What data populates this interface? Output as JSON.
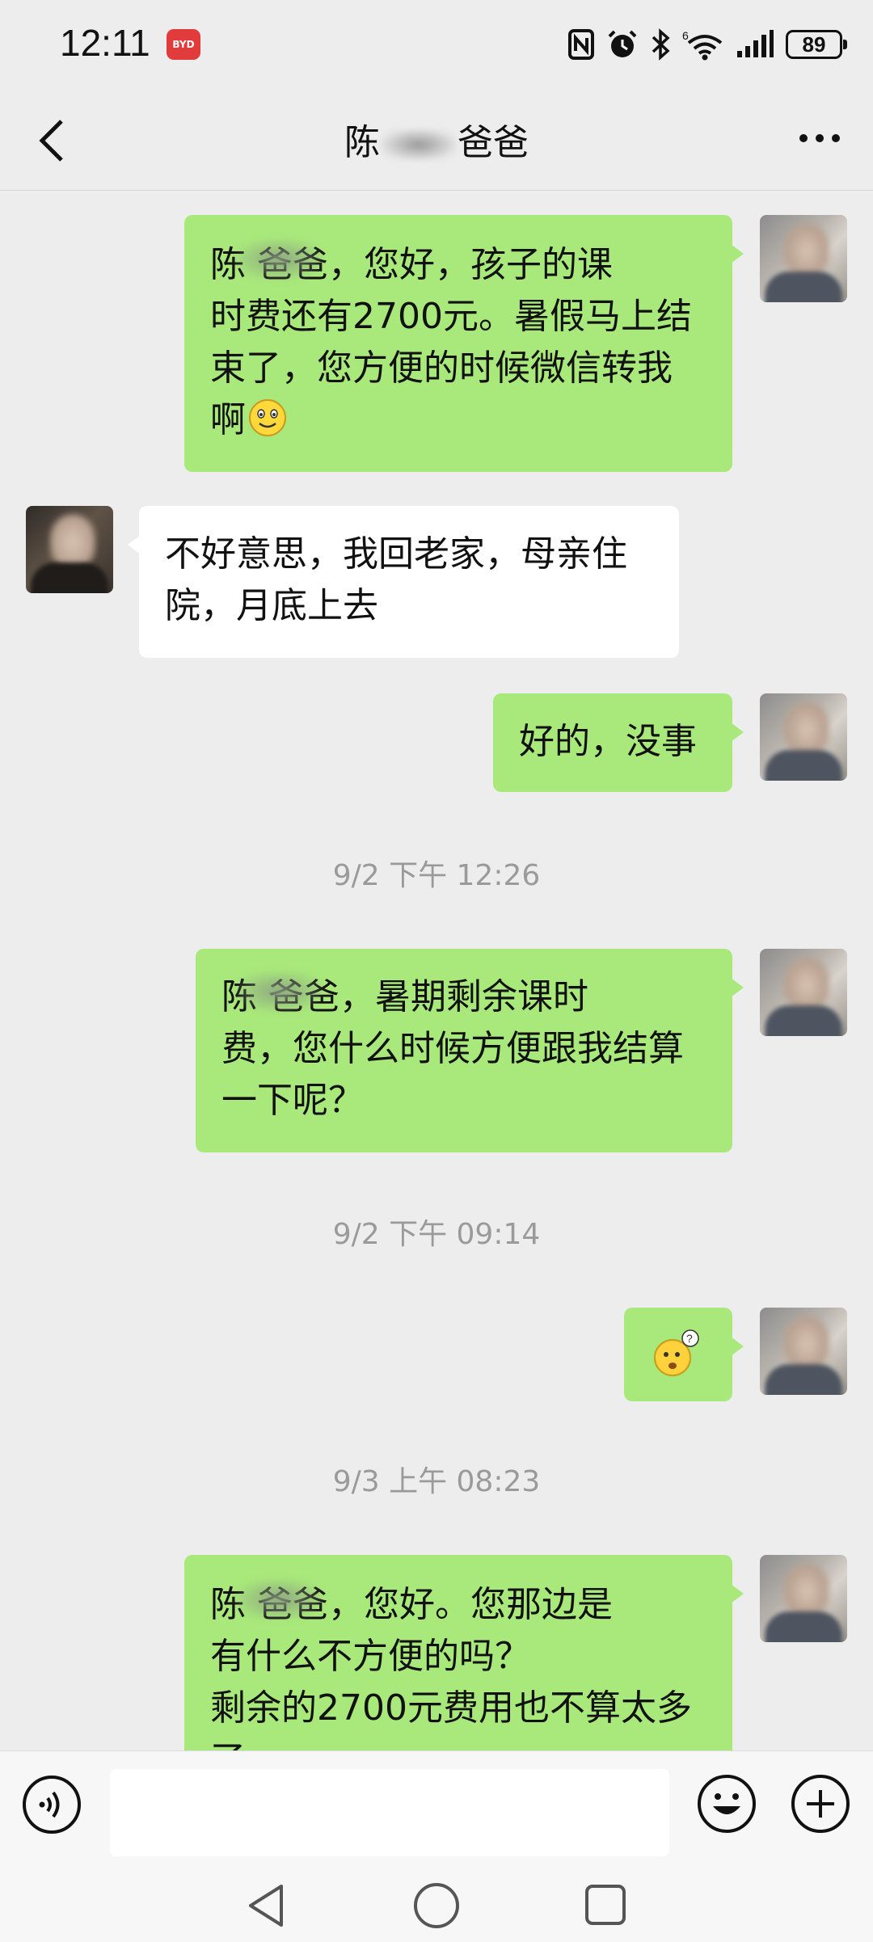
{
  "status_bar": {
    "time": "12:11",
    "car_badge": "BYD",
    "battery": "89",
    "network": "6"
  },
  "header": {
    "title_prefix": "陈",
    "title_suffix": "爸爸"
  },
  "messages": [
    {
      "from": "me",
      "lines": [
        "陈      爸爸，您好，孩子的课",
        "时费还有2700元。暑假马上结",
        "束了，您方便的时候微信转我",
        "啊"
      ],
      "emoji": "smile-emoji"
    },
    {
      "from": "other",
      "lines": [
        "不好意思，我回老家，母亲住",
        "院，月底上去"
      ]
    },
    {
      "from": "me",
      "lines": [
        "好的，没事"
      ]
    },
    {
      "type": "timestamp",
      "text": "9/2 下午 12:26"
    },
    {
      "from": "me",
      "lines": [
        "陈      爸爸，暑期剩余课时",
        "费，您什么时候方便跟我结算",
        "一下呢？"
      ]
    },
    {
      "type": "timestamp",
      "text": "9/2 下午 09:14"
    },
    {
      "from": "me",
      "emoji_only": "puzzled-emoji"
    },
    {
      "type": "timestamp",
      "text": "9/3 上午 08:23"
    },
    {
      "from": "me",
      "lines": [
        "陈      爸爸，您好。您那边是",
        "有什么不方便的吗？",
        "剩余的2700元费用也不算太多",
        "了"
      ]
    }
  ],
  "input": {
    "value": "",
    "placeholder": ""
  },
  "icons": {
    "back": "chevron-left-icon",
    "more": "more-dots-icon",
    "voice": "voice-icon",
    "emoji": "emoji-icon",
    "plus": "plus-icon"
  },
  "colors": {
    "my_bubble": "#a9e97b",
    "other_bubble": "#ffffff",
    "background": "#ededed",
    "timestamp": "#9a9a9a",
    "badge": "#e23b3b"
  }
}
